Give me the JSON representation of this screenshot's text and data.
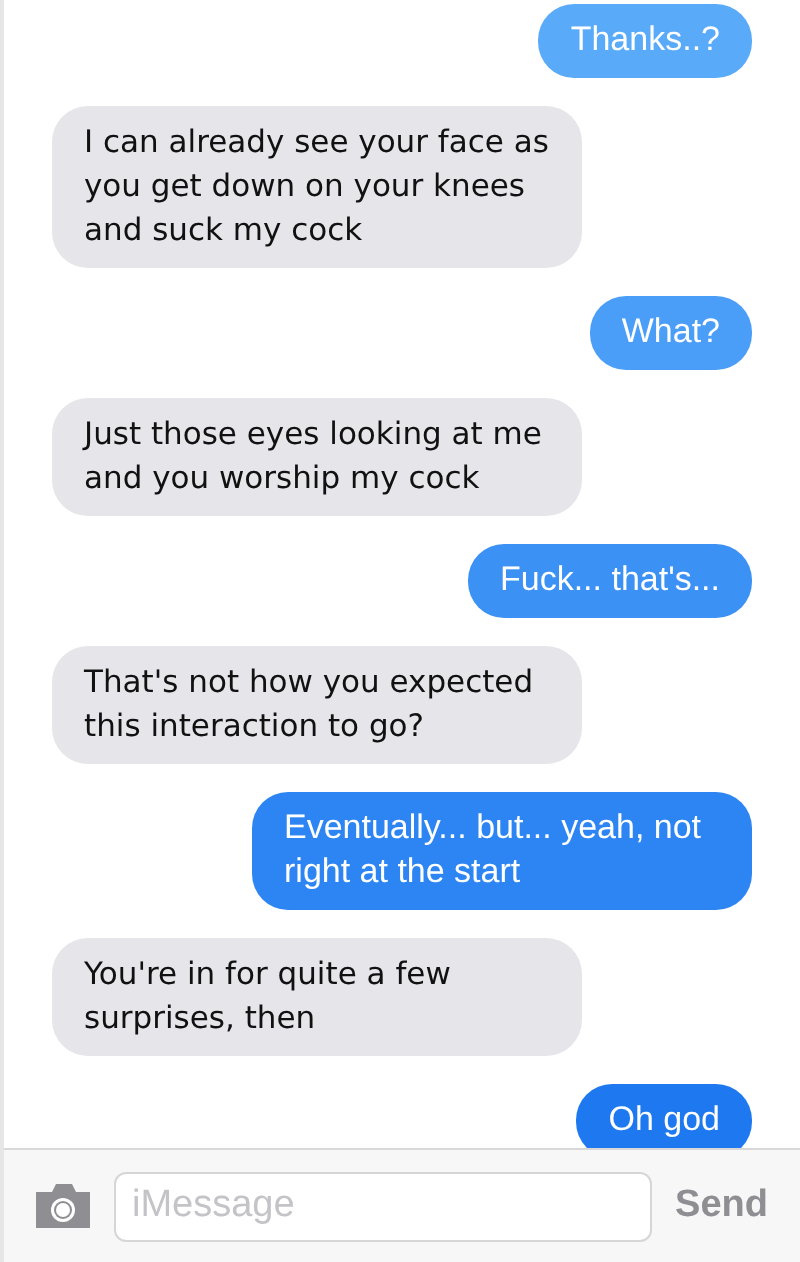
{
  "messages": [
    {
      "text": "Thanks..?",
      "outgoing": true
    },
    {
      "text": "I can already see your face as you get down on your knees and suck my cock",
      "outgoing": false
    },
    {
      "text": "What?",
      "outgoing": true
    },
    {
      "text": "Just those eyes looking at me and you worship my cock",
      "outgoing": false
    },
    {
      "text": "Fuck... that's...",
      "outgoing": true
    },
    {
      "text": "That's not how you expected this interaction to go?",
      "outgoing": false
    },
    {
      "text": "Eventually... but... yeah, not right at the start",
      "outgoing": true
    },
    {
      "text": "You're in for quite a few surprises, then",
      "outgoing": false
    },
    {
      "text": "Oh god",
      "outgoing": true
    }
  ],
  "composer": {
    "placeholder": "iMessage",
    "send": {
      "label": "Send",
      "disabled": true
    }
  }
}
